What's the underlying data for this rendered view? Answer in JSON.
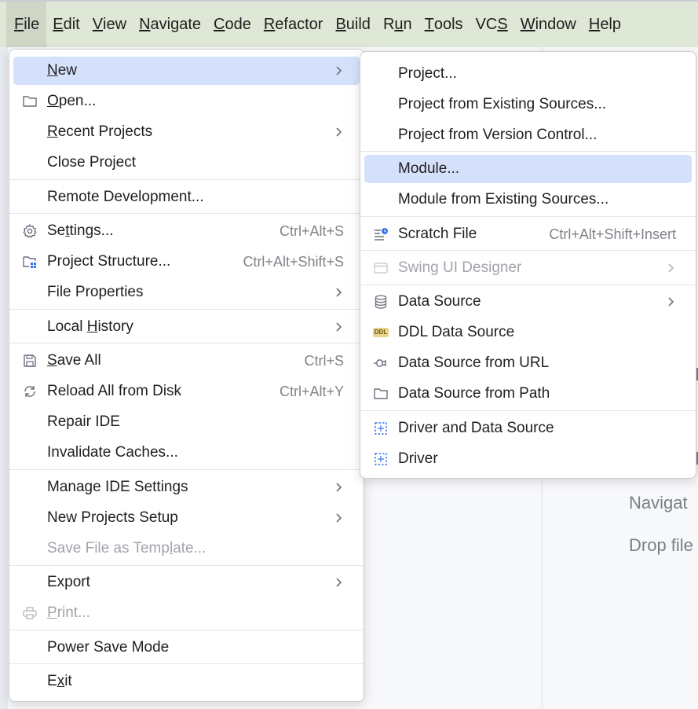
{
  "menubar": {
    "items": [
      {
        "mnemonic": "F",
        "rest": "ile",
        "name": "menu-file",
        "active": true
      },
      {
        "mnemonic": "E",
        "rest": "dit",
        "name": "menu-edit"
      },
      {
        "mnemonic": "V",
        "rest": "iew",
        "name": "menu-view"
      },
      {
        "mnemonic": "N",
        "rest": "avigate",
        "name": "menu-navigate"
      },
      {
        "mnemonic": "C",
        "rest": "ode",
        "name": "menu-code"
      },
      {
        "mnemonic": "R",
        "rest": "efactor",
        "name": "menu-refactor"
      },
      {
        "mnemonic": "B",
        "rest": "uild",
        "name": "menu-build"
      },
      {
        "pre": "R",
        "mnemonic": "u",
        "rest": "n",
        "name": "menu-run"
      },
      {
        "mnemonic": "T",
        "rest": "ools",
        "name": "menu-tools"
      },
      {
        "pre": "VC",
        "mnemonic": "S",
        "rest": "",
        "name": "menu-vcs"
      },
      {
        "mnemonic": "W",
        "rest": "indow",
        "name": "menu-window"
      },
      {
        "mnemonic": "H",
        "rest": "elp",
        "name": "menu-help"
      }
    ]
  },
  "background": {
    "navigate_hint": "Navigat",
    "drop_hint": "Drop file"
  },
  "file_menu": {
    "new": {
      "mnemonic": "N",
      "rest": "ew"
    },
    "open": {
      "mnemonic": "O",
      "rest": "pen..."
    },
    "recent_projects": {
      "mnemonic": "R",
      "rest": "ecent Projects"
    },
    "close_project": {
      "pre": "Close Pro",
      "mnemonic": "j",
      "rest": "ect"
    },
    "remote_development": "Remote Development...",
    "settings": {
      "pre": "Se",
      "mnemonic": "t",
      "rest": "tings...",
      "shortcut": "Ctrl+Alt+S"
    },
    "project_structure": {
      "label": "Project Structure...",
      "shortcut": "Ctrl+Alt+Shift+S"
    },
    "file_properties": "File Properties",
    "local_history": {
      "pre": "Local ",
      "mnemonic": "H",
      "rest": "istory"
    },
    "save_all": {
      "mnemonic": "S",
      "rest": "ave All",
      "shortcut": "Ctrl+S"
    },
    "reload_all": {
      "label": "Reload All from Disk",
      "shortcut": "Ctrl+Alt+Y"
    },
    "repair_ide": "Repair IDE",
    "invalidate_caches": "Invalidate Caches...",
    "manage_ide_settings": "Manage IDE Settings",
    "new_projects_setup": "New Projects Setup",
    "save_file_as_template": {
      "pre": "Save File as Temp",
      "mnemonic": "l",
      "rest": "ate..."
    },
    "export": "Export",
    "print": {
      "mnemonic": "P",
      "rest": "rint..."
    },
    "power_save_mode": "Power Save Mode",
    "exit": {
      "pre": "E",
      "mnemonic": "x",
      "rest": "it"
    }
  },
  "new_submenu": {
    "project": "Project...",
    "project_existing": "Project from Existing Sources...",
    "project_vcs": "Project from Version Control...",
    "module": "Module...",
    "module_existing": "Module from Existing Sources...",
    "scratch_file": {
      "label": "Scratch File",
      "shortcut": "Ctrl+Alt+Shift+Insert"
    },
    "swing_ui_designer": "Swing UI Designer",
    "data_source": "Data Source",
    "ddl_data_source": "DDL Data Source",
    "ddl_badge": "DDL",
    "data_source_url": "Data Source from URL",
    "data_source_path": "Data Source from Path",
    "driver_and_data_source": "Driver and Data Source",
    "driver": "Driver"
  },
  "colors": {
    "menubar_bg": "#dfe8d6",
    "selection": "#d5e1fb",
    "disabled_text": "#a1a4aa",
    "accent_blue": "#3574f0"
  }
}
